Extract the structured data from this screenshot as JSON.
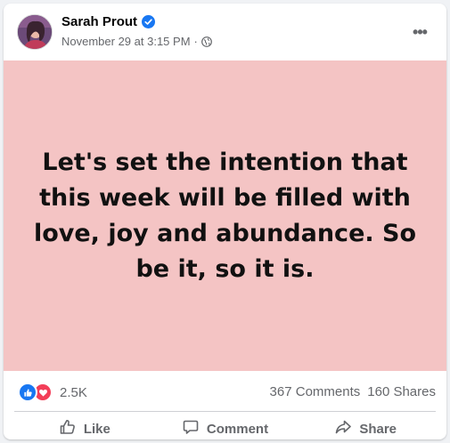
{
  "post": {
    "author": "Sarah Prout",
    "timestamp": "November 29 at 3:15 PM",
    "separator": "·",
    "more_label": "•••",
    "body_text": "Let's set the intention that this week will be filled with love, joy and abundance. So be it, so it is.",
    "background_color": "#f4c4c4"
  },
  "stats": {
    "reaction_count": "2.5K",
    "comments": "367 Comments",
    "shares": "160 Shares"
  },
  "actions": {
    "like": "Like",
    "comment": "Comment",
    "share": "Share"
  },
  "icons": {
    "verified": "verified-badge-icon",
    "privacy": "globe-icon",
    "like_reaction": "like-reaction-icon",
    "love_reaction": "love-reaction-icon",
    "like_action": "thumbs-up-icon",
    "comment_action": "comment-bubble-icon",
    "share_action": "share-arrow-icon"
  },
  "colors": {
    "accent": "#1877f2",
    "love": "#f33e58",
    "secondary_text": "#65676b"
  }
}
